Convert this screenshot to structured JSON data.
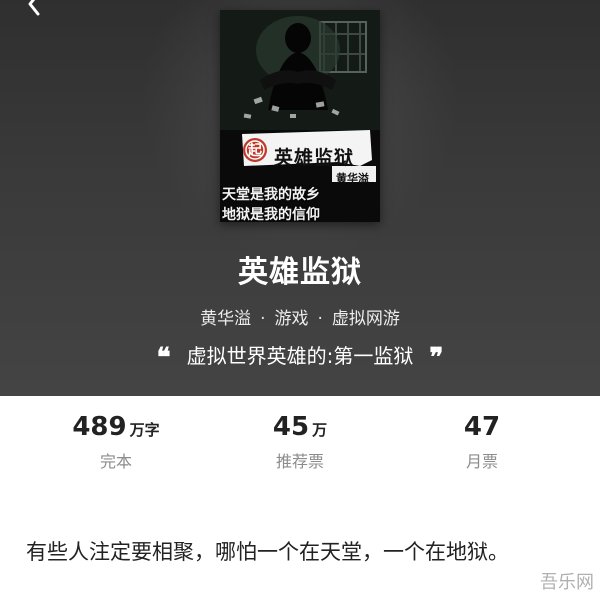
{
  "header": {
    "back_icon": "back-arrow-icon"
  },
  "cover": {
    "title": "英雄监狱",
    "badge": "起",
    "author": "黄华溢",
    "line1": "天堂是我的故乡",
    "line2": "地狱是我的信仰"
  },
  "book": {
    "title": "英雄监狱",
    "author": "黄华溢",
    "category": "游戏",
    "subcategory": "虚拟网游",
    "separator": "·",
    "tagline": "虚拟世界英雄的:第一监狱",
    "quote_open": "❝",
    "quote_close": "❞"
  },
  "stats": {
    "words": {
      "value": "489",
      "unit": "万字",
      "label": "完本"
    },
    "recommend": {
      "value": "45",
      "unit": "万",
      "label": "推荐票"
    },
    "monthly": {
      "value": "47",
      "label": "月票"
    }
  },
  "intro": {
    "text": "有些人注定要相聚，哪怕一个在天堂，一个在地狱。"
  },
  "watermark": "吾乐网"
}
